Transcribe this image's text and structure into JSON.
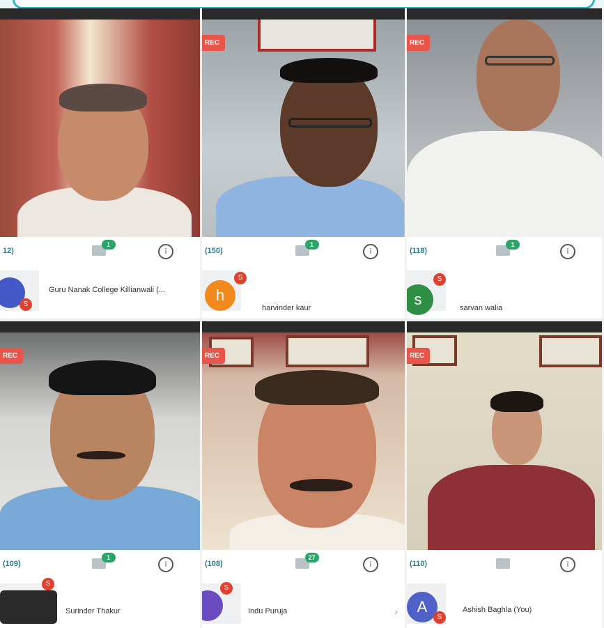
{
  "participants": [
    {
      "status_left": "",
      "status_right": "",
      "rec": "",
      "users": "12)",
      "chat_badge": "1",
      "info": "i",
      "name": "Guru Nanak College Killianwali (...",
      "initial": "",
      "badge_letter": "S",
      "color": "#4457c6"
    },
    {
      "status_left": "",
      "status_right": "",
      "rec": "REC",
      "users": "(150)",
      "chat_badge": "1",
      "info": "i",
      "name": "harvinder kaur",
      "initial": "h",
      "badge_letter": "S",
      "color": "#f08a1c"
    },
    {
      "status_left": "",
      "status_right": "",
      "rec": "REC",
      "users": "(118)",
      "chat_badge": "1",
      "info": "i",
      "name": "sarvan walia",
      "initial": "s",
      "badge_letter": "S",
      "color": "#2f8f46"
    },
    {
      "status_left": "",
      "status_right": "",
      "rec": "REC",
      "users": "(109)",
      "chat_badge": "1",
      "info": "i",
      "name": "Surinder Thakur",
      "initial": "",
      "badge_letter": "S",
      "color": "#2a2a2a"
    },
    {
      "status_left": "",
      "status_right": "",
      "rec": "REC",
      "users": "(108)",
      "chat_badge": "27",
      "info": "i",
      "name": "Indu Puruja",
      "initial": "",
      "badge_letter": "S",
      "color": "#6b4bc0"
    },
    {
      "status_left": "",
      "status_right": "",
      "rec": "REC",
      "users": "(110)",
      "chat_badge": "",
      "info": "i",
      "name": "Ashish Baghla (You)",
      "initial": "A",
      "badge_letter": "S",
      "color": "#4f61c7"
    }
  ],
  "colors": {
    "accent": "#2fb4c4",
    "rec": "#e8554a",
    "badge": "#2aa56a",
    "avatar_badge": "#e0412f"
  }
}
